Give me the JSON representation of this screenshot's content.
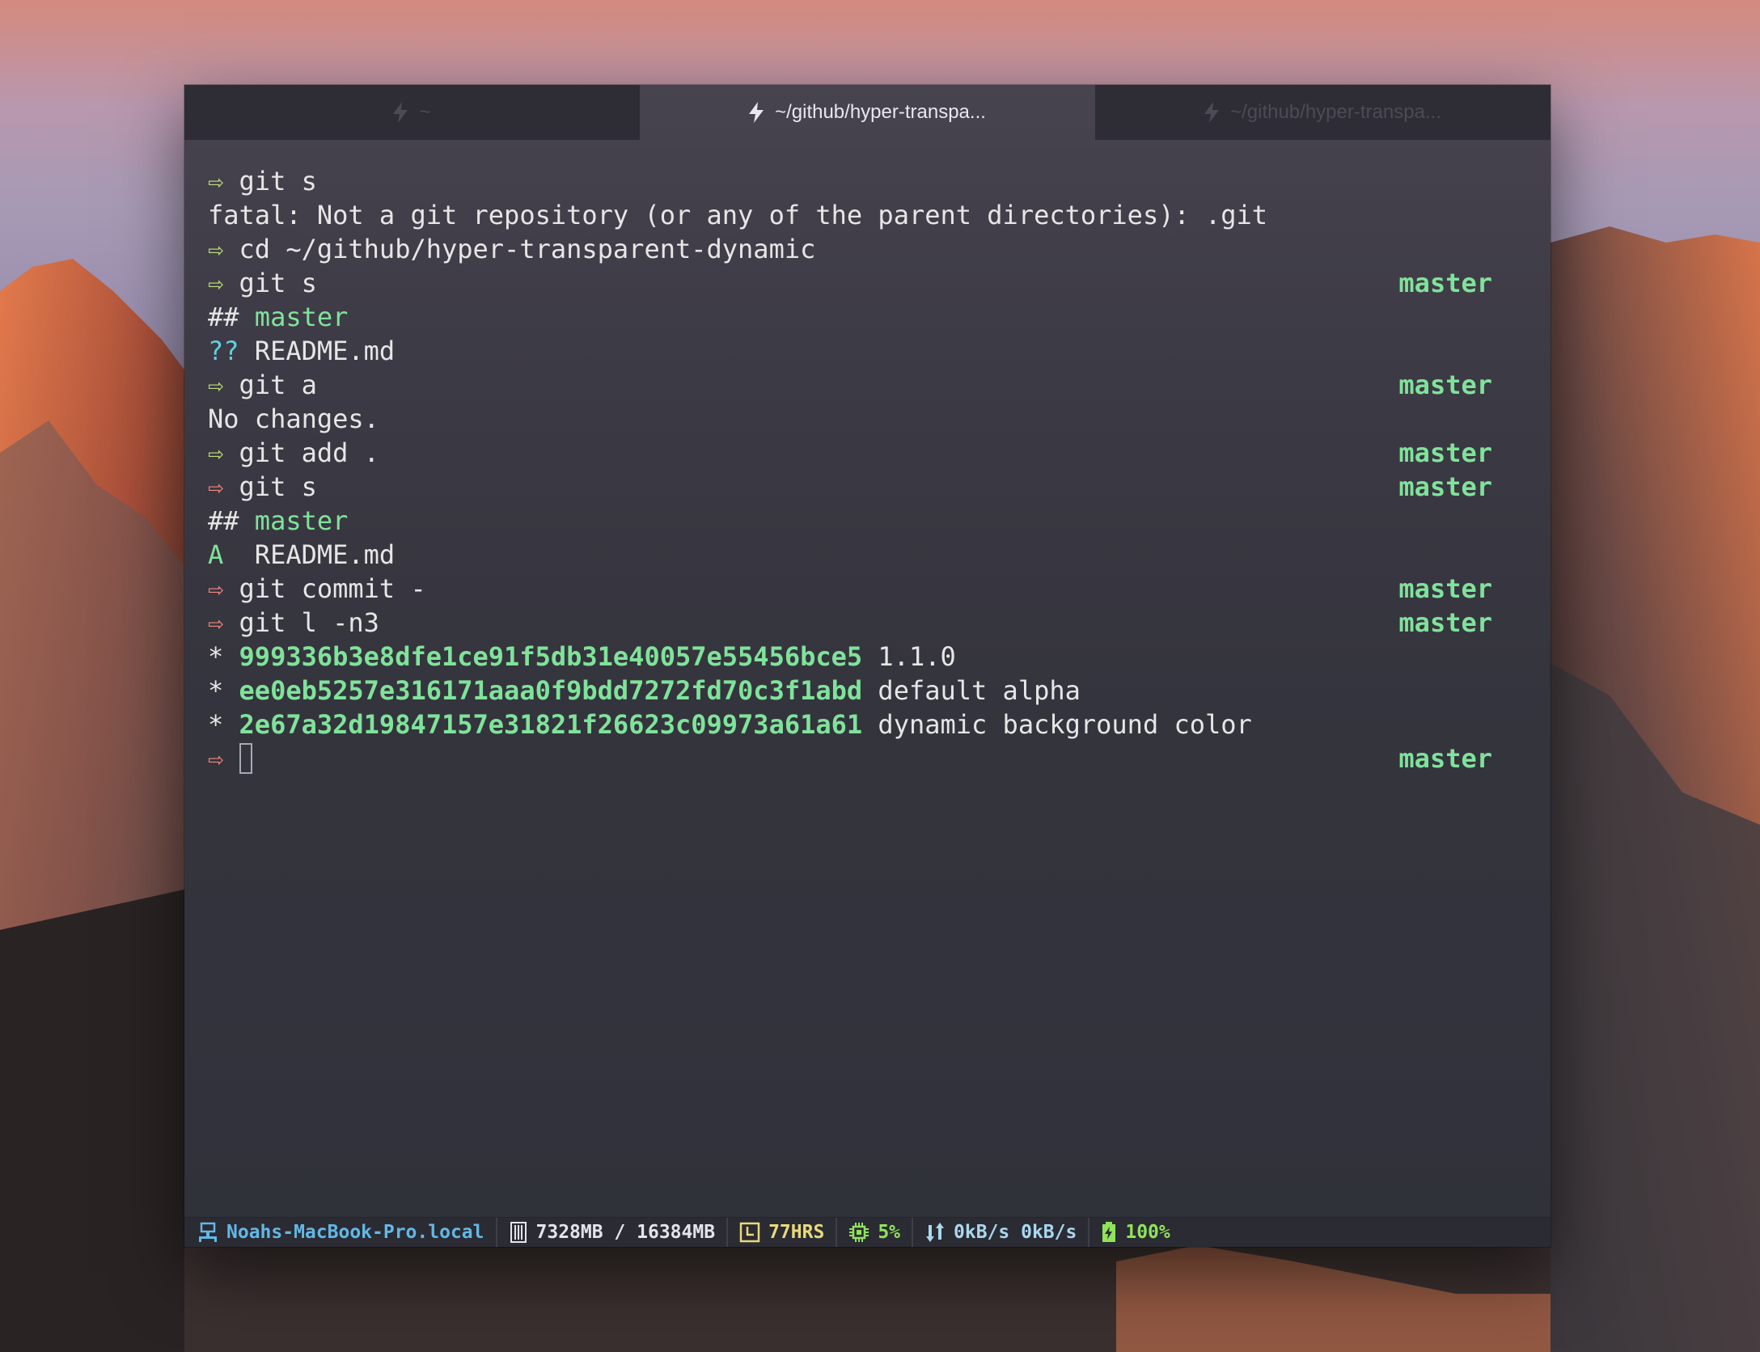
{
  "tabs": [
    {
      "label": "~"
    },
    {
      "label": "~/github/hyper-transpa..."
    },
    {
      "label": "~/github/hyper-transpa..."
    }
  ],
  "terminal": {
    "lines": [
      {
        "arrow": "⇨",
        "text": " git s"
      },
      {
        "text": "fatal: Not a git repository (or any of the parent directories): .git"
      },
      {
        "arrow": "⇨",
        "text": " cd ~/github/hyper-transparent-dynamic"
      },
      {
        "arrow": "⇨",
        "text": " git s",
        "branch": "master"
      },
      {
        "prefix": "## ",
        "branch_text": "master"
      },
      {
        "prefix": "?? ",
        "text": "README.md"
      },
      {
        "arrow": "⇨",
        "text": " git a",
        "branch": "master"
      },
      {
        "text": "No changes."
      },
      {
        "arrow": "⇨",
        "text": " git add .",
        "branch": "master"
      },
      {
        "arrow": "⇨",
        "text": " git s",
        "branch": "master"
      },
      {
        "prefix": "## ",
        "branch_text": "master"
      },
      {
        "prefix": "A  ",
        "text": "README.md"
      },
      {
        "arrow": "⇨",
        "text": " git commit -",
        "branch": "master"
      },
      {
        "arrow": "⇨",
        "text": " git l -n3",
        "branch": "master"
      },
      {
        "star": "* ",
        "hash": "999336b3e8dfe1ce91f5db31e40057e55456bce5",
        "text": " 1.1.0"
      },
      {
        "star": "* ",
        "hash": "ee0eb5257e316171aaa0f9bdd7272fd70c3f1abd",
        "text": " default alpha"
      },
      {
        "star": "* ",
        "hash": "2e67a32d19847157e31821f26623c09973a61a61",
        "text": " dynamic background color"
      },
      {
        "arrow": "⇨",
        "text": " ",
        "branch": "master"
      }
    ]
  },
  "statusbar": {
    "hostname": "Noahs-MacBook-Pro.local",
    "memory": "7328MB / 16384MB",
    "uptime": "77HRS",
    "cpu": "5%",
    "network": "0kB/s 0kB/s",
    "battery": "100%"
  },
  "colors": {
    "branch": "#7fe39a",
    "arrow_ok": "#bfe07a",
    "arrow_err": "#f08a80",
    "untracked": "#5fd0df",
    "host": "#62b8e6",
    "uptime": "#e8da7a"
  }
}
